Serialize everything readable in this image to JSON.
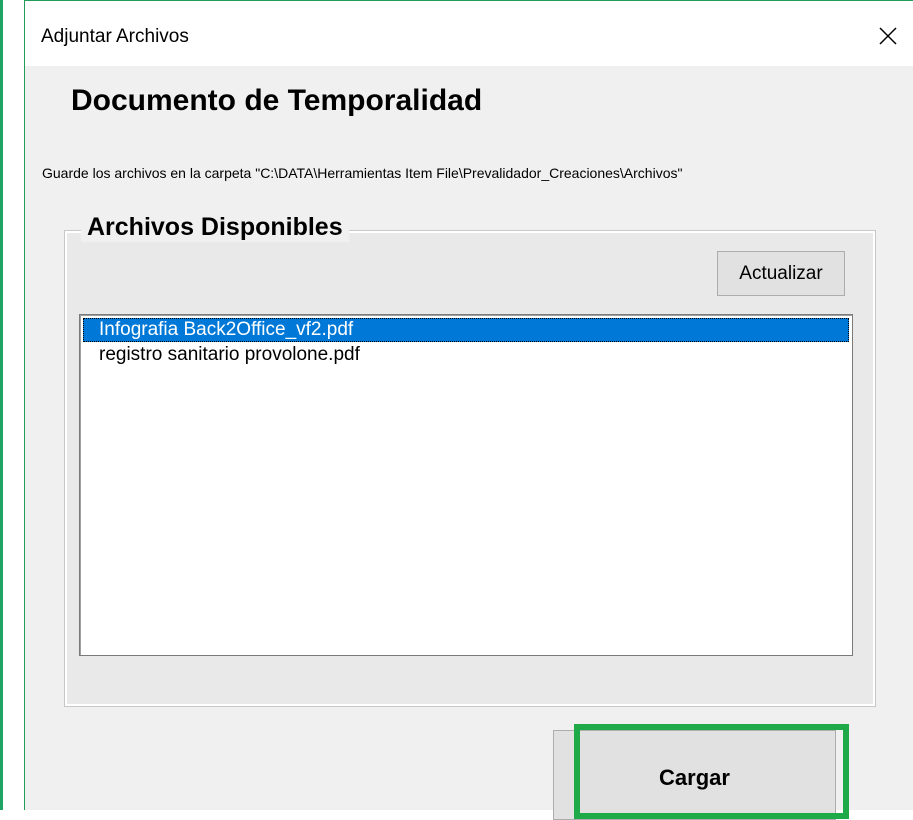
{
  "window": {
    "title": "Adjuntar Archivos",
    "close_icon": "close-icon"
  },
  "header": {
    "title": "Documento de Temporalidad",
    "path_note": "Guarde los archivos en la carpeta \"C:\\DATA\\Herramientas Item File\\Prevalidador_Creaciones\\Archivos\""
  },
  "files_group": {
    "legend": "Archivos Disponibles",
    "refresh_label": "Actualizar",
    "items": [
      {
        "label": "Infografia Back2Office_vf2.pdf",
        "selected": true
      },
      {
        "label": "registro sanitario provolone.pdf",
        "selected": false
      }
    ]
  },
  "footer": {
    "upload_label": "Cargar"
  },
  "colors": {
    "selection": "#0078d7",
    "highlight": "#1faa4a"
  }
}
